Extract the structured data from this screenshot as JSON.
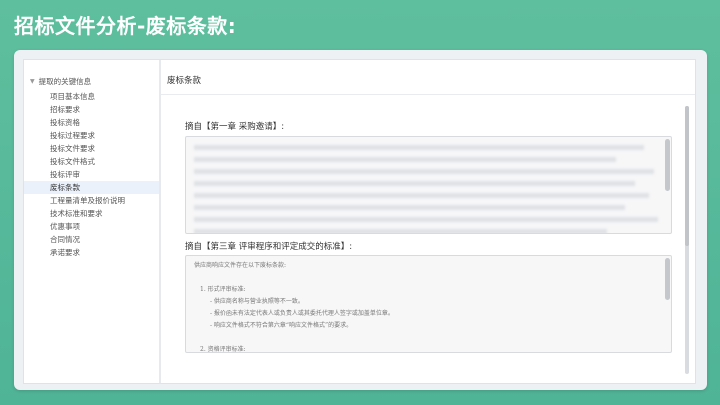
{
  "slide": {
    "title": "招标文件分析-废标条款:"
  },
  "sidebar": {
    "root_label": "提取的关键信息",
    "items": [
      {
        "label": "项目基本信息"
      },
      {
        "label": "招标要求"
      },
      {
        "label": "投标资格"
      },
      {
        "label": "投标过程要求"
      },
      {
        "label": "投标文件要求"
      },
      {
        "label": "投标文件格式"
      },
      {
        "label": "投标评审"
      },
      {
        "label": "废标条款"
      },
      {
        "label": "工程量清单及报价说明"
      },
      {
        "label": "技术标准和要求"
      },
      {
        "label": "优惠事项"
      },
      {
        "label": "合同情况"
      },
      {
        "label": "承诺要求"
      }
    ],
    "active_index": 7
  },
  "main": {
    "title": "废标条款",
    "sections": [
      {
        "label": "摘自【第一章 采购邀请】:",
        "blurred": true
      },
      {
        "label": "摘自【第三章 评审程序和评定成交的标准】:",
        "intro": "供应商响应文件存在以下废标条款:",
        "list": [
          {
            "heading": "1. 形式评审标准:",
            "items": [
              "- 供应商名称与营业执照等不一致。",
              "- 报价函未有法定代表人或负责人或其委托代理人签字或加盖单位章。",
              "- 响应文件格式不符合第六章“响应文件格式”的要求。"
            ]
          },
          {
            "heading": "2. 资格评审标准:",
            "items": []
          }
        ]
      }
    ]
  }
}
